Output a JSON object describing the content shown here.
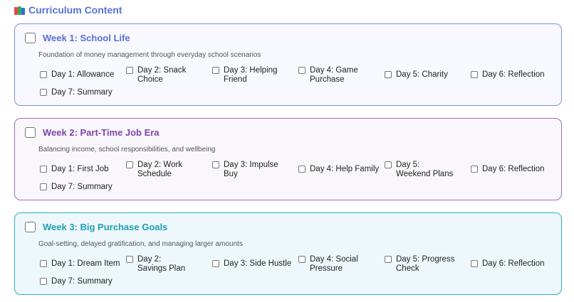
{
  "section": {
    "title": "Curriculum Content",
    "icon": "books-icon"
  },
  "weeks": [
    {
      "title": "Week 1: School Life",
      "description": "Foundation of money management through everyday school scenarios",
      "color": "#5b6fd9",
      "border": "#7a8ee8",
      "background": "#f8f9ff",
      "days": [
        "Day 1: Allowance",
        "Day 2: Snack Choice",
        "Day 3: Helping Friend",
        "Day 4: Game Purchase",
        "Day 5: Charity",
        "Day 6: Reflection",
        "Day 7: Summary"
      ]
    },
    {
      "title": "Week 2: Part-Time Job Era",
      "description": "Balancing income, school responsibilities, and wellbeing",
      "color": "#7d44a8",
      "border": "#9a6fc0",
      "background": "#faf7fc",
      "days": [
        "Day 1: First Job",
        "Day 2: Work Schedule",
        "Day 3: Impulse Buy",
        "Day 4: Help Family",
        "Day 5: Weekend Plans",
        "Day 6: Reflection",
        "Day 7: Summary"
      ]
    },
    {
      "title": "Week 3: Big Purchase Goals",
      "description": "Goal-setting, delayed gratification, and managing larger amounts",
      "color": "#1e9fb0",
      "border": "#2cb1b8",
      "background": "#eef8fc",
      "days": [
        "Day 1: Dream Item",
        "Day 2: Savings Plan",
        "Day 3: Side Hustle",
        "Day 4: Social Pressure",
        "Day 5: Progress Check",
        "Day 6: Reflection",
        "Day 7: Summary"
      ]
    }
  ]
}
